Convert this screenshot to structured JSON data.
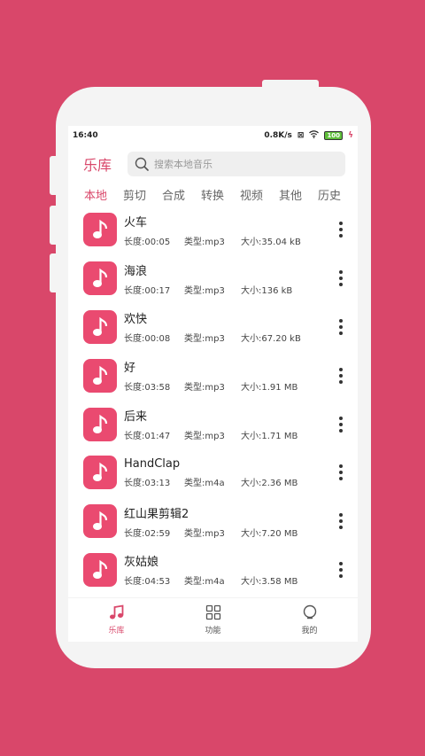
{
  "status": {
    "time": "16:40",
    "speed": "0.8K/s",
    "battery": "100"
  },
  "header": {
    "title": "乐库",
    "search_placeholder": "搜索本地音乐"
  },
  "tabs": [
    "本地",
    "剪切",
    "合成",
    "转换",
    "视频",
    "其他",
    "历史"
  ],
  "songs": [
    {
      "name": "火车",
      "length": "长度:00:05",
      "type": "类型:mp3",
      "size": "大小:35.04 kB"
    },
    {
      "name": "海浪",
      "length": "长度:00:17",
      "type": "类型:mp3",
      "size": "大小:136 kB"
    },
    {
      "name": "欢快",
      "length": "长度:00:08",
      "type": "类型:mp3",
      "size": "大小:67.20 kB"
    },
    {
      "name": "好",
      "length": "长度:03:58",
      "type": "类型:mp3",
      "size": "大小:1.91 MB"
    },
    {
      "name": "后来",
      "length": "长度:01:47",
      "type": "类型:mp3",
      "size": "大小:1.71 MB"
    },
    {
      "name": "HandClap",
      "length": "长度:03:13",
      "type": "类型:m4a",
      "size": "大小:2.36 MB"
    },
    {
      "name": "红山果剪辑2",
      "length": "长度:02:59",
      "type": "类型:mp3",
      "size": "大小:7.20 MB"
    },
    {
      "name": "灰姑娘",
      "length": "长度:04:53",
      "type": "类型:m4a",
      "size": "大小:3.58 MB"
    }
  ],
  "nav": [
    {
      "label": "乐库",
      "icon": "music-note-icon"
    },
    {
      "label": "功能",
      "icon": "grid-icon"
    },
    {
      "label": "我的",
      "icon": "profile-icon"
    }
  ],
  "colors": {
    "accent": "#D9476A",
    "thumb": "#EA4A70"
  }
}
